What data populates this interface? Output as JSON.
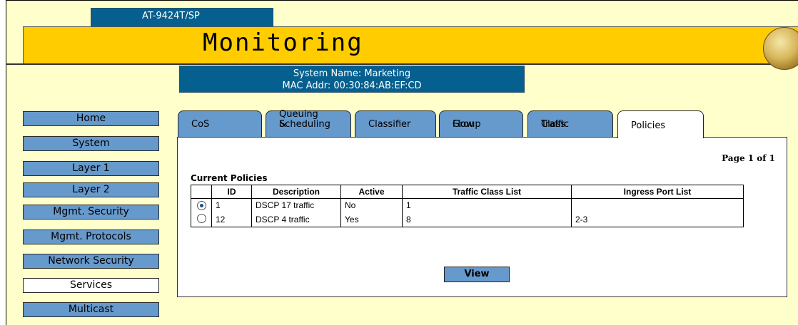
{
  "header": {
    "model": "AT-9424T/SP",
    "title": "Monitoring",
    "system_name": "System Name: Marketing",
    "mac_addr": "MAC Addr: 00:30:84:AB:EF:CD"
  },
  "sidebar": {
    "items": [
      {
        "label": "Home",
        "active": false
      },
      {
        "label": "System",
        "active": false
      },
      {
        "label": "Layer 1",
        "active": false
      },
      {
        "label": "Layer 2",
        "active": false
      },
      {
        "label": "Mgmt. Security",
        "active": false
      },
      {
        "label": "Mgmt. Protocols",
        "active": false
      },
      {
        "label": "Network Security",
        "active": false
      },
      {
        "label": "Services",
        "active": true
      },
      {
        "label": "Multicast",
        "active": false
      }
    ]
  },
  "tabs": [
    {
      "line1": "",
      "line2": "CoS"
    },
    {
      "line1": "Queuing &",
      "line2": "Scheduling"
    },
    {
      "line1": "",
      "line2": "Classifier"
    },
    {
      "line1": "Flow",
      "line2": "Group"
    },
    {
      "line1": "Traffic",
      "line2": "Class"
    },
    {
      "line1": "",
      "line2": "Policies",
      "active": true
    }
  ],
  "content": {
    "page_indicator": "Page 1 of 1",
    "table_caption": "Current Policies",
    "columns": [
      "",
      "ID",
      "Description",
      "Active",
      "Traffic Class List",
      "Ingress Port List"
    ],
    "rows": [
      {
        "selected": true,
        "id": "1",
        "description": "DSCP 17 traffic",
        "active": "No",
        "traffic_class_list": "1",
        "ingress_port_list": ""
      },
      {
        "selected": false,
        "id": "12",
        "description": "DSCP 4 traffic",
        "active": "Yes",
        "traffic_class_list": "8",
        "ingress_port_list": "2-3"
      }
    ],
    "view_button": "View"
  },
  "colors": {
    "background": "#ffffcc",
    "banner": "#ffcc00",
    "header_blue": "#06608f",
    "button_blue": "#6699cc"
  }
}
